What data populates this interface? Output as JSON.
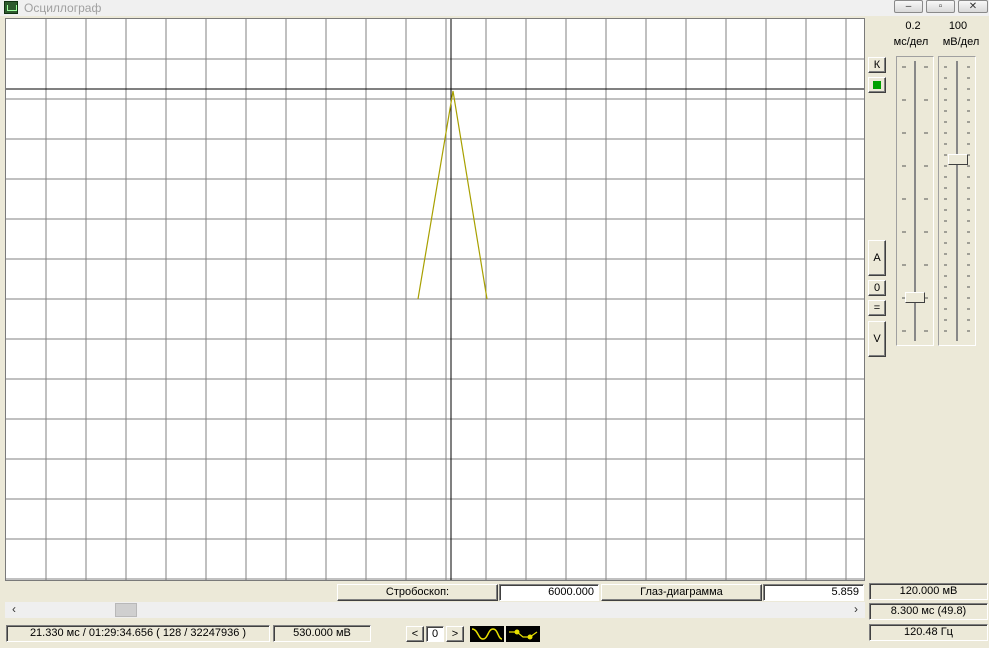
{
  "window": {
    "title": "Осциллограф",
    "buttons": {
      "minimize": "‒",
      "restore": "▫",
      "close": "✕"
    }
  },
  "scale": {
    "time_value": "0.2",
    "time_unit": "мс/дел",
    "volt_value": "100",
    "volt_unit": "мВ/дел",
    "time_slider_level": 0.85,
    "volt_slider_level": 0.35
  },
  "side_buttons": {
    "k": "К",
    "a": "A",
    "zero": "0",
    "equals": "=",
    "v": "V"
  },
  "strobe": {
    "label": "Стробоскоп:",
    "value": "6000.000"
  },
  "eye": {
    "label": "Глаз-диаграмма",
    "value": "5.859"
  },
  "readouts": {
    "voltage": "120.000 мВ",
    "time": "8.300 мс (49.8)",
    "frequency": "120.48 Гц"
  },
  "status": {
    "position": "21.330 мс / 01:29:34.656 ( 128 / 32247936 )",
    "level": "530.000 мВ"
  },
  "nav": {
    "prev": "<",
    "index": "0",
    "next": ">"
  },
  "colors": {
    "trace": "#a8a000",
    "grid": "#808080",
    "cursor": "#000000"
  }
}
